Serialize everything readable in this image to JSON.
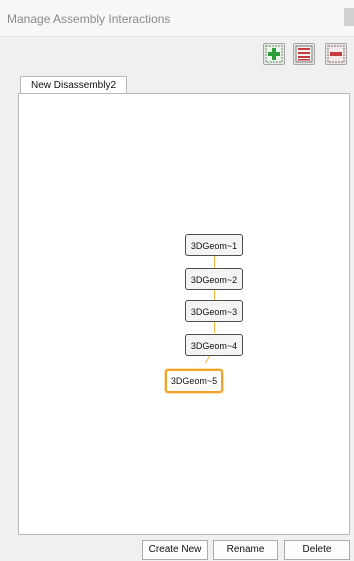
{
  "window": {
    "title": "Manage Assembly Interactions"
  },
  "toolbar": {
    "buttons": [
      {
        "icon": "add-icon",
        "color": "#2f9e3b"
      },
      {
        "icon": "list-icon",
        "color": "#c63b3b"
      },
      {
        "icon": "remove-icon",
        "color": "#c63b3b"
      }
    ]
  },
  "tabs": [
    {
      "label": "New Disassembly2",
      "active": true
    }
  ],
  "graph": {
    "nodes": [
      {
        "label": "3DGeom~1",
        "selected": false
      },
      {
        "label": "3DGeom~2",
        "selected": false
      },
      {
        "label": "3DGeom~3",
        "selected": false
      },
      {
        "label": "3DGeom~4",
        "selected": false
      },
      {
        "label": "3DGeom~5",
        "selected": true
      }
    ],
    "link_color": "#f5b33b",
    "selected_color": "#f0a22c"
  },
  "actions": {
    "create_new": "Create New",
    "rename": "Rename",
    "delete": "Delete"
  }
}
